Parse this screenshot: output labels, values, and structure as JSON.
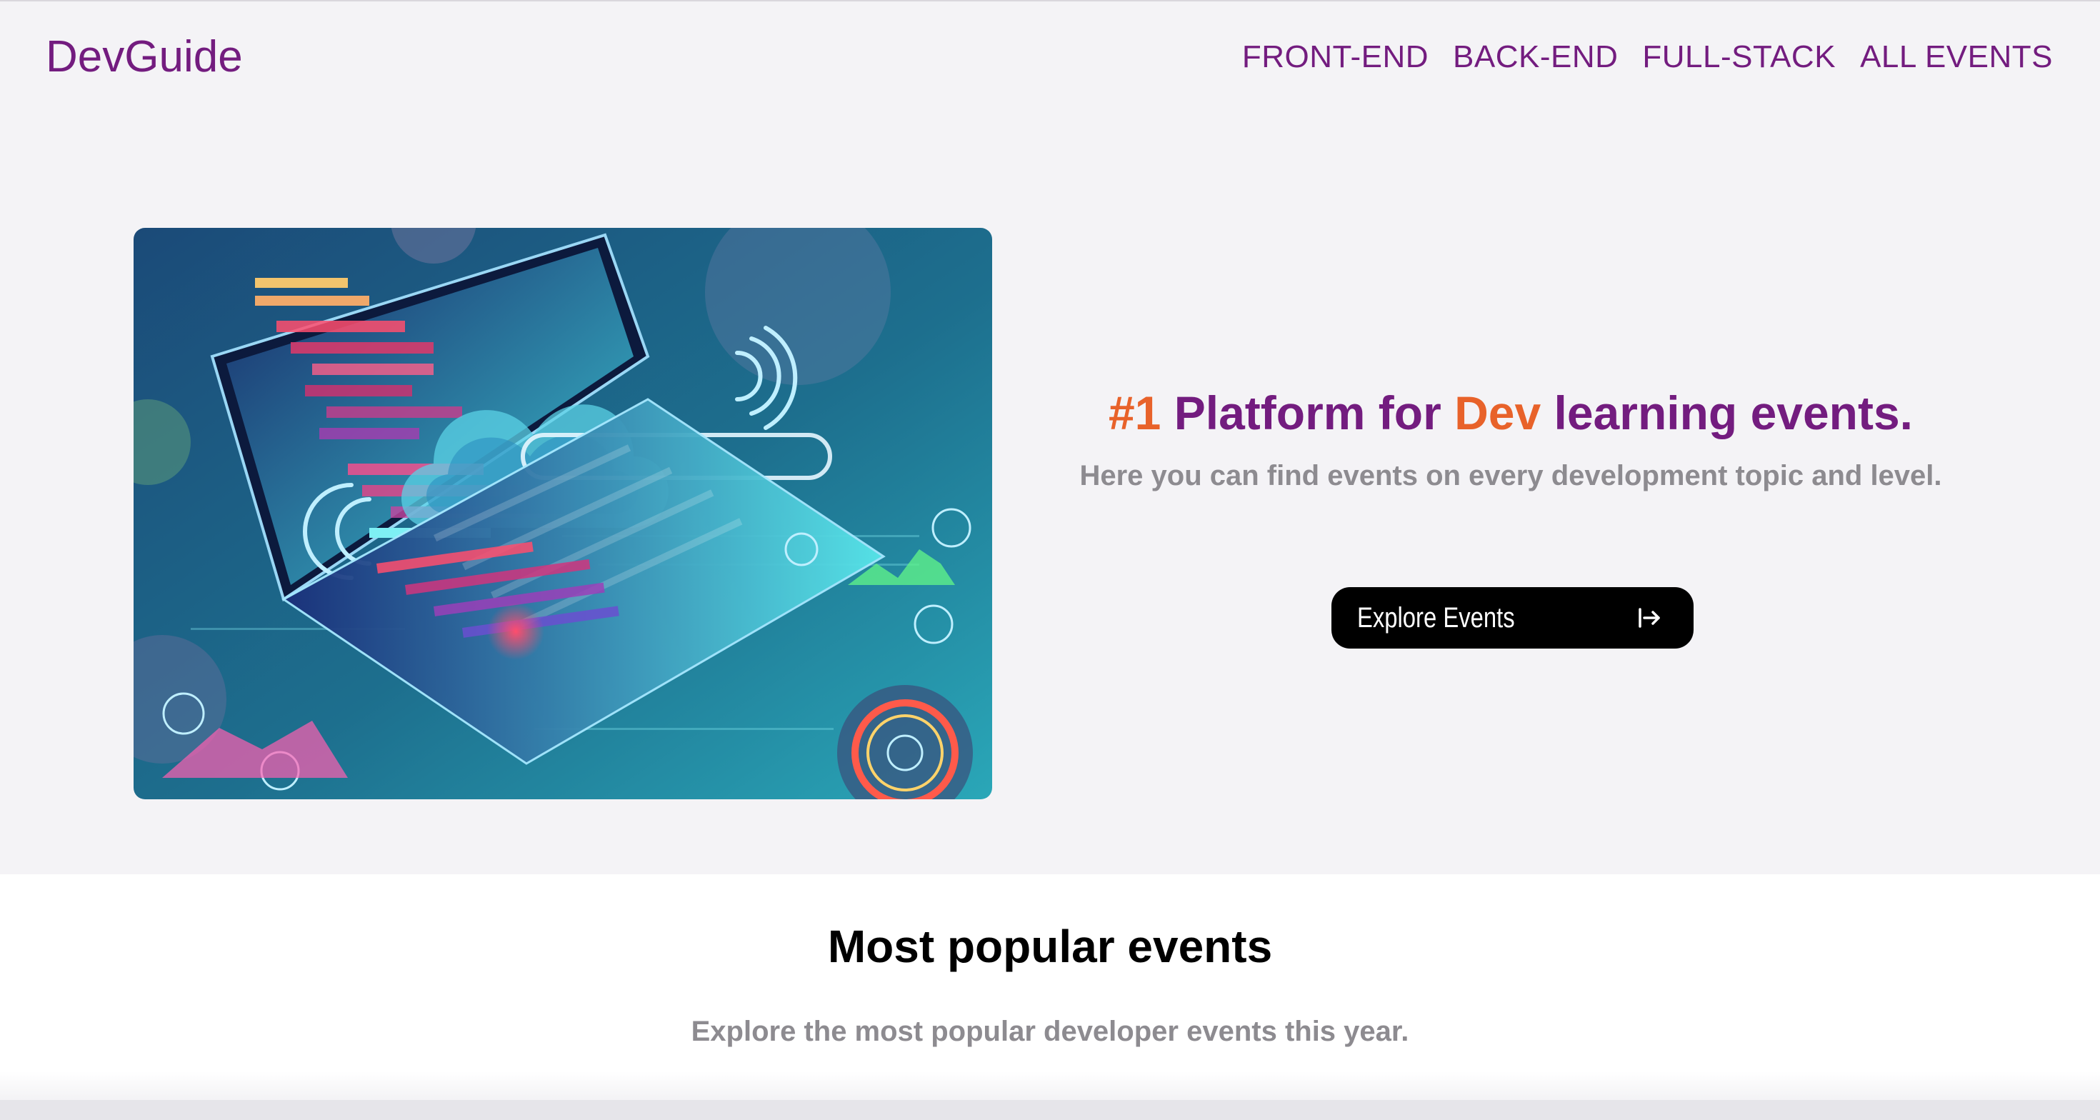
{
  "header": {
    "logo": "DevGuide",
    "nav": [
      {
        "label": "FRONT-END"
      },
      {
        "label": "BACK-END"
      },
      {
        "label": "FULL-STACK"
      },
      {
        "label": "ALL EVENTS"
      }
    ]
  },
  "hero": {
    "headline_part1": "#1",
    "headline_part2": " Platform for ",
    "headline_part3": "Dev",
    "headline_part4": " learning events.",
    "subtitle": "Here you can find events on every development topic and level.",
    "cta_label": "Explore Events",
    "cta_icon": "arrow-right-to-line-icon"
  },
  "popular": {
    "title": "Most popular events",
    "subtitle": "Explore the most popular developer events this year."
  },
  "colors": {
    "brand_purple": "#731c7f",
    "accent_orange": "#e8622a",
    "muted_gray": "#8d8b90",
    "page_bg": "#f4f3f6",
    "button_bg": "#000000"
  }
}
